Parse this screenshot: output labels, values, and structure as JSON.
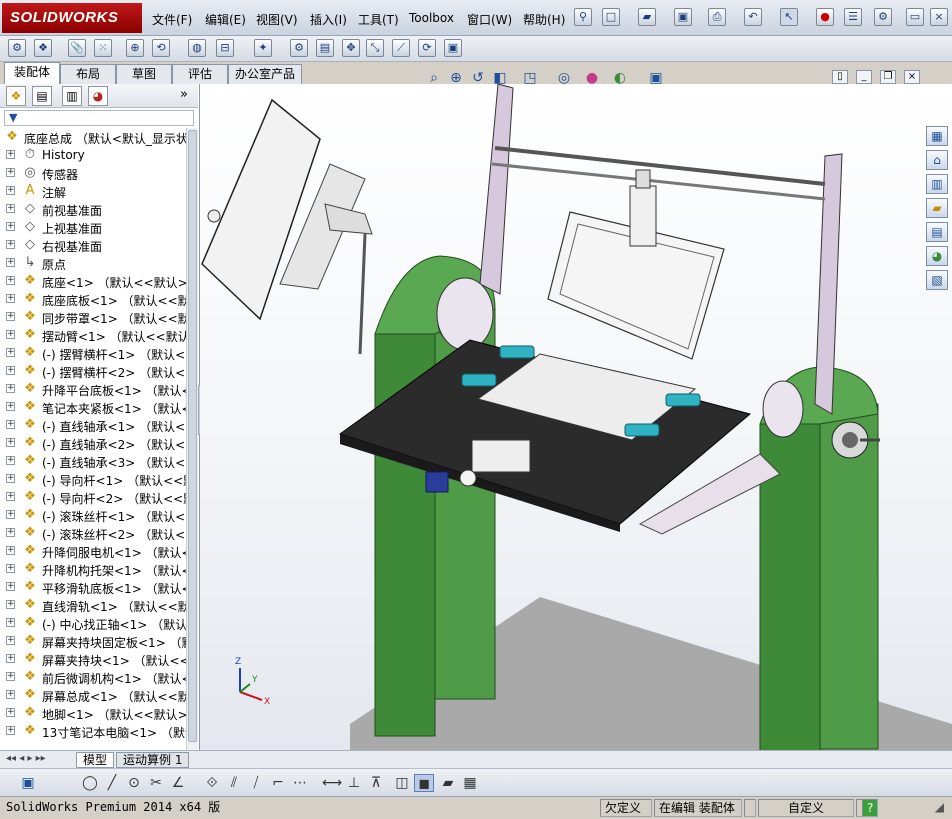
{
  "app": {
    "brand": "SOLIDWORKS",
    "menu": [
      "文件(F)",
      "编辑(E)",
      "视图(V)",
      "插入(I)",
      "工具(T)",
      "Toolbox",
      "窗口(W)",
      "帮助(H)"
    ]
  },
  "command_tabs": [
    "装配体",
    "布局",
    "草图",
    "评估",
    "办公室产品"
  ],
  "tree": {
    "root": "底座总成 （默认<默认_显示状",
    "items": [
      {
        "label": "History",
        "icon": "history-icon",
        "glyph": "⏱",
        "cls": "plane"
      },
      {
        "label": "传感器",
        "icon": "sensor-icon",
        "glyph": "◎",
        "cls": "plane"
      },
      {
        "label": "注解",
        "icon": "annotation-icon",
        "glyph": "A",
        "cls": "part"
      },
      {
        "label": "前视基准面",
        "icon": "plane-icon",
        "glyph": "◇",
        "cls": "plane"
      },
      {
        "label": "上视基准面",
        "icon": "plane-icon",
        "glyph": "◇",
        "cls": "plane"
      },
      {
        "label": "右视基准面",
        "icon": "plane-icon",
        "glyph": "◇",
        "cls": "plane"
      },
      {
        "label": "原点",
        "icon": "origin-icon",
        "glyph": "↳",
        "cls": "plane"
      },
      {
        "label": "底座<1> （默认<<默认>_显",
        "icon": "part-icon",
        "glyph": "❖",
        "cls": "part"
      },
      {
        "label": "底座底板<1> （默认<<默认",
        "icon": "part-icon",
        "glyph": "❖",
        "cls": "part"
      },
      {
        "label": "同步带罩<1> （默认<<默认",
        "icon": "part-icon",
        "glyph": "❖",
        "cls": "part"
      },
      {
        "label": "摆动臂<1> （默认<<默认>_",
        "icon": "part-icon",
        "glyph": "❖",
        "cls": "part"
      },
      {
        "label": "(-) 摆臂横杆<1> （默认<<",
        "icon": "part-icon",
        "glyph": "❖",
        "cls": "part"
      },
      {
        "label": "(-) 摆臂横杆<2> （默认<<",
        "icon": "part-icon",
        "glyph": "❖",
        "cls": "part"
      },
      {
        "label": "升降平台底板<1> （默认<<",
        "icon": "part-icon",
        "glyph": "❖",
        "cls": "part"
      },
      {
        "label": "笔记本夹紧板<1> （默认<<",
        "icon": "part-icon",
        "glyph": "❖",
        "cls": "part"
      },
      {
        "label": "(-) 直线轴承<1> （默认<<",
        "icon": "part-icon",
        "glyph": "❖",
        "cls": "part"
      },
      {
        "label": "(-) 直线轴承<2> （默认<<",
        "icon": "part-icon",
        "glyph": "❖",
        "cls": "part"
      },
      {
        "label": "(-) 直线轴承<3> （默认<<",
        "icon": "part-icon",
        "glyph": "❖",
        "cls": "part"
      },
      {
        "label": "(-) 导向杆<1> （默认<<默",
        "icon": "part-icon",
        "glyph": "❖",
        "cls": "part"
      },
      {
        "label": "(-) 导向杆<2> （默认<<默",
        "icon": "part-icon",
        "glyph": "❖",
        "cls": "part"
      },
      {
        "label": "(-) 滚珠丝杆<1> （默认<<",
        "icon": "part-icon",
        "glyph": "❖",
        "cls": "part"
      },
      {
        "label": "(-) 滚珠丝杆<2> （默认<<",
        "icon": "part-icon",
        "glyph": "❖",
        "cls": "part"
      },
      {
        "label": "升降伺服电机<1> （默认<<",
        "icon": "part-icon",
        "glyph": "❖",
        "cls": "part"
      },
      {
        "label": "升降机构托架<1> （默认<<",
        "icon": "part-icon",
        "glyph": "❖",
        "cls": "part"
      },
      {
        "label": "平移滑轨底板<1> （默认<<",
        "icon": "part-icon",
        "glyph": "❖",
        "cls": "part"
      },
      {
        "label": "直线滑轨<1> （默认<<默认",
        "icon": "part-icon",
        "glyph": "❖",
        "cls": "part"
      },
      {
        "label": "(-) 中心找正轴<1> （默认<",
        "icon": "part-icon",
        "glyph": "❖",
        "cls": "part"
      },
      {
        "label": "屏幕夹持块固定板<1> （默",
        "icon": "part-icon",
        "glyph": "❖",
        "cls": "part"
      },
      {
        "label": "屏幕夹持块<1> （默认<<默",
        "icon": "part-icon",
        "glyph": "❖",
        "cls": "part"
      },
      {
        "label": "前后微调机构<1> （默认<<",
        "icon": "part-icon",
        "glyph": "❖",
        "cls": "part"
      },
      {
        "label": "屏幕总成<1> （默认<<默认",
        "icon": "part-icon",
        "glyph": "❖",
        "cls": "part"
      },
      {
        "label": "地脚<1> （默认<<默认>_显",
        "icon": "part-icon",
        "glyph": "❖",
        "cls": "part"
      },
      {
        "label": "13寸笔记本电脑<1> （默认",
        "icon": "part-icon",
        "glyph": "❖",
        "cls": "part"
      }
    ]
  },
  "model_tabs": [
    "模型",
    "运动算例 1"
  ],
  "status": {
    "product": "SolidWorks Premium 2014 x64 版",
    "def": "欠定义",
    "editing": "在编辑 装配体",
    "units": "自定义"
  },
  "axes": {
    "x": "X",
    "y": "Y",
    "z": "Z"
  },
  "colors": {
    "green": "#3e8a38",
    "plate": "#2b2b2b",
    "cyan": "#2fb3c2",
    "frame": "#d6c9dd"
  }
}
